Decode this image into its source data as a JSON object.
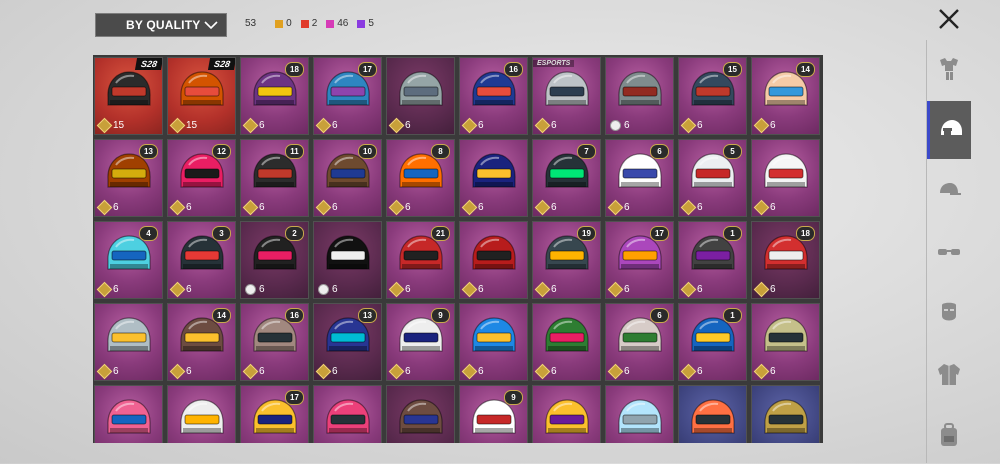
{
  "filter": {
    "label": "BY QUALITY"
  },
  "counts": {
    "total": "53",
    "items": [
      {
        "value": "0",
        "color": "#e0a020"
      },
      {
        "value": "2",
        "color": "#e03a2a"
      },
      {
        "value": "46",
        "color": "#d63bb7"
      },
      {
        "value": "5",
        "color": "#8a3be0"
      }
    ]
  },
  "tiles": [
    {
      "badge": "S28",
      "badge_type": "season",
      "qty": "15",
      "bg": "red",
      "icon": "diamond",
      "h": "#2b2b2b",
      "v": "#c0392b"
    },
    {
      "badge": "S28",
      "badge_type": "season",
      "qty": "15",
      "bg": "red",
      "icon": "diamond",
      "h": "#d35400",
      "v": "#e74c3c"
    },
    {
      "badge": "18",
      "badge_type": "level",
      "qty": "6",
      "bg": "purple",
      "icon": "diamond",
      "h": "#6c3483",
      "v": "#f1c40f"
    },
    {
      "badge": "17",
      "badge_type": "level",
      "qty": "6",
      "bg": "purple",
      "icon": "diamond",
      "h": "#2e86c1",
      "v": "#8e44ad"
    },
    {
      "badge": "",
      "badge_type": "none",
      "qty": "6",
      "bg": "dark",
      "icon": "diamond",
      "h": "#95a5a6",
      "v": "#5d6d7e"
    },
    {
      "badge": "16",
      "badge_type": "level",
      "qty": "6",
      "bg": "purple",
      "icon": "diamond",
      "h": "#1f3a93",
      "v": "#e74c3c"
    },
    {
      "badge": "ESPORTS",
      "badge_type": "esports",
      "qty": "6",
      "bg": "purple",
      "icon": "diamond",
      "h": "#bdc3c7",
      "v": "#2c3e50"
    },
    {
      "badge": "",
      "badge_type": "none",
      "qty": "6",
      "bg": "purple",
      "icon": "cloud",
      "h": "#7f8c8d",
      "v": "#922b21"
    },
    {
      "badge": "15",
      "badge_type": "level",
      "qty": "6",
      "bg": "purple",
      "icon": "diamond",
      "h": "#34495e",
      "v": "#c0392b"
    },
    {
      "badge": "14",
      "badge_type": "level",
      "qty": "6",
      "bg": "purple",
      "icon": "diamond",
      "h": "#f5cba7",
      "v": "#3498db"
    },
    {
      "badge": "13",
      "badge_type": "level",
      "qty": "6",
      "bg": "purple",
      "icon": "diamond",
      "h": "#a04000",
      "v": "#d4ac0d"
    },
    {
      "badge": "12",
      "badge_type": "level",
      "qty": "6",
      "bg": "purple",
      "icon": "diamond",
      "h": "#e91e63",
      "v": "#1a1a1a"
    },
    {
      "badge": "11",
      "badge_type": "level",
      "qty": "6",
      "bg": "purple",
      "icon": "diamond",
      "h": "#2c2c2c",
      "v": "#c0392b"
    },
    {
      "badge": "10",
      "badge_type": "level",
      "qty": "6",
      "bg": "purple",
      "icon": "diamond",
      "h": "#6e4a2f",
      "v": "#1f3a93"
    },
    {
      "badge": "8",
      "badge_type": "level",
      "qty": "6",
      "bg": "purple",
      "icon": "diamond",
      "h": "#ff6f00",
      "v": "#1565c0"
    },
    {
      "badge": "",
      "badge_type": "none",
      "qty": "6",
      "bg": "purple",
      "icon": "diamond",
      "h": "#1a237e",
      "v": "#fbc02d"
    },
    {
      "badge": "7",
      "badge_type": "level",
      "qty": "6",
      "bg": "purple",
      "icon": "diamond",
      "h": "#263238",
      "v": "#00e676"
    },
    {
      "badge": "6",
      "badge_type": "level",
      "qty": "6",
      "bg": "purple",
      "icon": "diamond",
      "h": "#ffffff",
      "v": "#3949ab"
    },
    {
      "badge": "5",
      "badge_type": "level",
      "qty": "6",
      "bg": "purple",
      "icon": "diamond",
      "h": "#eceff1",
      "v": "#c62828"
    },
    {
      "badge": "",
      "badge_type": "none",
      "qty": "6",
      "bg": "purple",
      "icon": "diamond",
      "h": "#f5f5f5",
      "v": "#d32f2f"
    },
    {
      "badge": "4",
      "badge_type": "level",
      "qty": "6",
      "bg": "purple",
      "icon": "diamond",
      "h": "#4dd0e1",
      "v": "#1565c0"
    },
    {
      "badge": "3",
      "badge_type": "level",
      "qty": "6",
      "bg": "purple",
      "icon": "diamond",
      "h": "#263238",
      "v": "#e53935"
    },
    {
      "badge": "2",
      "badge_type": "level",
      "qty": "6",
      "bg": "dark",
      "icon": "cloud",
      "h": "#212121",
      "v": "#e91e63"
    },
    {
      "badge": "",
      "badge_type": "none",
      "qty": "6",
      "bg": "dark",
      "icon": "cloud",
      "h": "#111111",
      "v": "#eeeeee"
    },
    {
      "badge": "21",
      "badge_type": "level",
      "qty": "6",
      "bg": "purple",
      "icon": "diamond",
      "h": "#c62828",
      "v": "#212121"
    },
    {
      "badge": "",
      "badge_type": "none",
      "qty": "6",
      "bg": "purple",
      "icon": "diamond",
      "h": "#b71c1c",
      "v": "#212121"
    },
    {
      "badge": "19",
      "badge_type": "level",
      "qty": "6",
      "bg": "purple",
      "icon": "diamond",
      "h": "#37474f",
      "v": "#ffb300"
    },
    {
      "badge": "17",
      "badge_type": "level",
      "qty": "6",
      "bg": "purple",
      "icon": "diamond",
      "h": "#ab47bc",
      "v": "#ffa000"
    },
    {
      "badge": "1",
      "badge_type": "level",
      "qty": "6",
      "bg": "purple",
      "icon": "diamond",
      "h": "#424242",
      "v": "#7b1fa2"
    },
    {
      "badge": "18",
      "badge_type": "level",
      "qty": "6",
      "bg": "dark",
      "icon": "diamond",
      "h": "#d32f2f",
      "v": "#eeeeee"
    },
    {
      "badge": "",
      "badge_type": "none",
      "qty": "6",
      "bg": "purple",
      "icon": "diamond",
      "h": "#b0bec5",
      "v": "#fbc02d"
    },
    {
      "badge": "14",
      "badge_type": "level",
      "qty": "6",
      "bg": "purple",
      "icon": "diamond",
      "h": "#6d4c41",
      "v": "#fbc02d"
    },
    {
      "badge": "16",
      "badge_type": "level",
      "qty": "6",
      "bg": "purple",
      "icon": "diamond",
      "h": "#a1887f",
      "v": "#263238"
    },
    {
      "badge": "13",
      "badge_type": "level",
      "qty": "6",
      "bg": "dark",
      "icon": "diamond",
      "h": "#283593",
      "v": "#00bcd4"
    },
    {
      "badge": "9",
      "badge_type": "level",
      "qty": "6",
      "bg": "purple",
      "icon": "diamond",
      "h": "#eeeeee",
      "v": "#1a237e"
    },
    {
      "badge": "",
      "badge_type": "none",
      "qty": "6",
      "bg": "purple",
      "icon": "diamond",
      "h": "#1e88e5",
      "v": "#fbc02d"
    },
    {
      "badge": "",
      "badge_type": "none",
      "qty": "6",
      "bg": "purple",
      "icon": "diamond",
      "h": "#2e7d32",
      "v": "#e91e63"
    },
    {
      "badge": "6",
      "badge_type": "level",
      "qty": "6",
      "bg": "purple",
      "icon": "diamond",
      "h": "#d7ccc8",
      "v": "#2e7d32"
    },
    {
      "badge": "1",
      "badge_type": "level",
      "qty": "6",
      "bg": "purple",
      "icon": "diamond",
      "h": "#1565c0",
      "v": "#ffca28"
    },
    {
      "badge": "",
      "badge_type": "none",
      "qty": "6",
      "bg": "purple",
      "icon": "diamond",
      "h": "#c5c08a",
      "v": "#263238"
    },
    {
      "badge": "",
      "badge_type": "none",
      "qty": "",
      "bg": "purple",
      "icon": "none",
      "h": "#f06292",
      "v": "#1565c0"
    },
    {
      "badge": "",
      "badge_type": "none",
      "qty": "",
      "bg": "purple",
      "icon": "none",
      "h": "#eeeeee",
      "v": "#ffb300"
    },
    {
      "badge": "17",
      "badge_type": "level",
      "qty": "",
      "bg": "purple",
      "icon": "none",
      "h": "#fbc02d",
      "v": "#1a237e"
    },
    {
      "badge": "",
      "badge_type": "none",
      "qty": "",
      "bg": "purple",
      "icon": "none",
      "h": "#ec407a",
      "v": "#263238"
    },
    {
      "badge": "",
      "badge_type": "none",
      "qty": "",
      "bg": "dark",
      "icon": "none",
      "h": "#6d4c41",
      "v": "#283593"
    },
    {
      "badge": "9",
      "badge_type": "level",
      "qty": "",
      "bg": "purple",
      "icon": "none",
      "h": "#ffffff",
      "v": "#c62828"
    },
    {
      "badge": "",
      "badge_type": "none",
      "qty": "",
      "bg": "purple",
      "icon": "none",
      "h": "#fbc02d",
      "v": "#6a1b9a"
    },
    {
      "badge": "",
      "badge_type": "none",
      "qty": "",
      "bg": "purple",
      "icon": "none",
      "h": "#b3e5fc",
      "v": "#90a4ae"
    },
    {
      "badge": "",
      "badge_type": "none",
      "qty": "",
      "bg": "blue",
      "icon": "none",
      "h": "#ff7043",
      "v": "#263238"
    },
    {
      "badge": "",
      "badge_type": "none",
      "qty": "",
      "bg": "blue",
      "icon": "none",
      "h": "#bfa046",
      "v": "#263238"
    }
  ],
  "sidebar": {
    "items": [
      {
        "name": "outfit",
        "active": false
      },
      {
        "name": "helmet",
        "active": true
      },
      {
        "name": "cap",
        "active": false
      },
      {
        "name": "glasses",
        "active": false
      },
      {
        "name": "mask",
        "active": false
      },
      {
        "name": "jacket",
        "active": false
      },
      {
        "name": "backpack",
        "active": false
      }
    ]
  }
}
